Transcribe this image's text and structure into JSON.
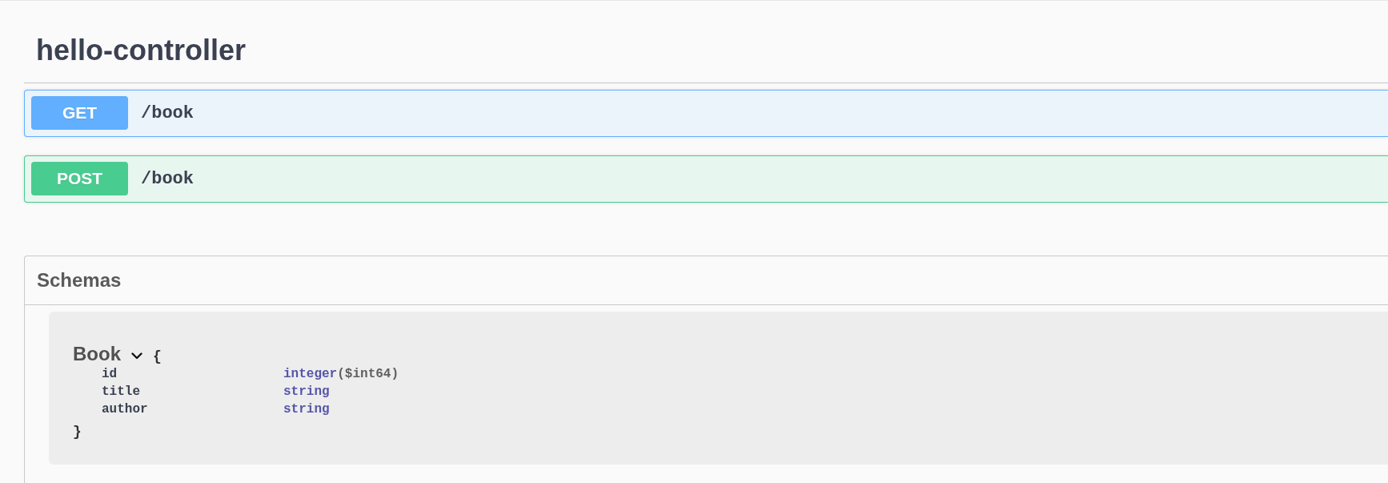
{
  "tag": {
    "title": "hello-controller"
  },
  "operations": [
    {
      "kind": "get",
      "method": "GET",
      "path": "/book"
    },
    {
      "kind": "post",
      "method": "POST",
      "path": "/book"
    }
  ],
  "schemas": {
    "title": "Schemas",
    "models": [
      {
        "name": "Book",
        "expanded": true,
        "open_brace": "{",
        "close_brace": "}",
        "properties": [
          {
            "name": "id",
            "type": "integer",
            "format": "($int64)"
          },
          {
            "name": "title",
            "type": "string"
          },
          {
            "name": "author",
            "type": "string"
          }
        ]
      }
    ]
  }
}
